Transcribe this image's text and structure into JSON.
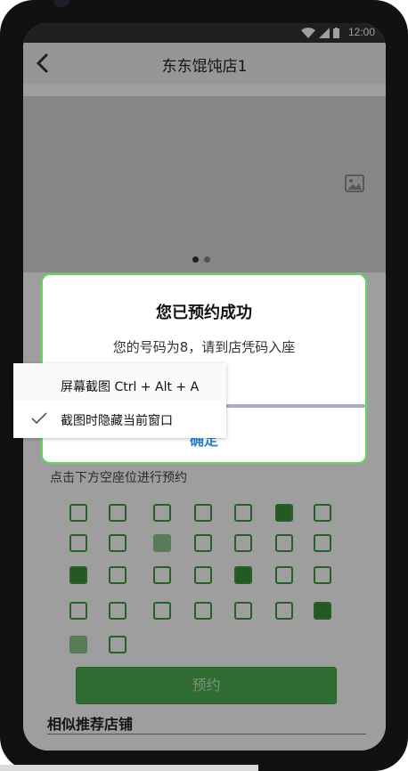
{
  "status_bar": {
    "time": "12:00",
    "icons": [
      "wifi-icon",
      "signal-icon",
      "battery-icon"
    ]
  },
  "header": {
    "title": "东东馄饨店1",
    "back_icon": "chevron-left-icon"
  },
  "banner": {
    "image_icon": "image-icon",
    "slide_count": 2,
    "active_slide": 1
  },
  "seat_hint": "点击下方空座位进行预约",
  "seats": [
    [
      "empty",
      "empty",
      "empty",
      "empty",
      "empty",
      "taken",
      "empty"
    ],
    [
      "empty",
      "empty",
      "light",
      "empty",
      "empty",
      "empty",
      "empty"
    ],
    [
      "taken",
      "empty",
      "empty",
      "empty",
      "taken",
      "empty",
      "empty"
    ],
    [
      "empty",
      "empty",
      "empty",
      "empty",
      "empty",
      "empty",
      "taken"
    ],
    [
      "light",
      "empty"
    ]
  ],
  "reserve_button": "预约",
  "similar_section": "相似推荐店铺",
  "dialog": {
    "title": "您已预约成功",
    "message": "您的号码为8，请到店凭码入座",
    "confirm": "确定"
  },
  "context_menu": {
    "items": [
      {
        "label": "屏幕截图 Ctrl + Alt + A",
        "checked": false
      },
      {
        "label": "截图时隐藏当前窗口",
        "checked": true
      }
    ]
  },
  "colors": {
    "accent": "#4caf50",
    "seat_border": "#3f9a3f",
    "dialog_border": "#5ed85e",
    "link": "#2e7fd0"
  }
}
